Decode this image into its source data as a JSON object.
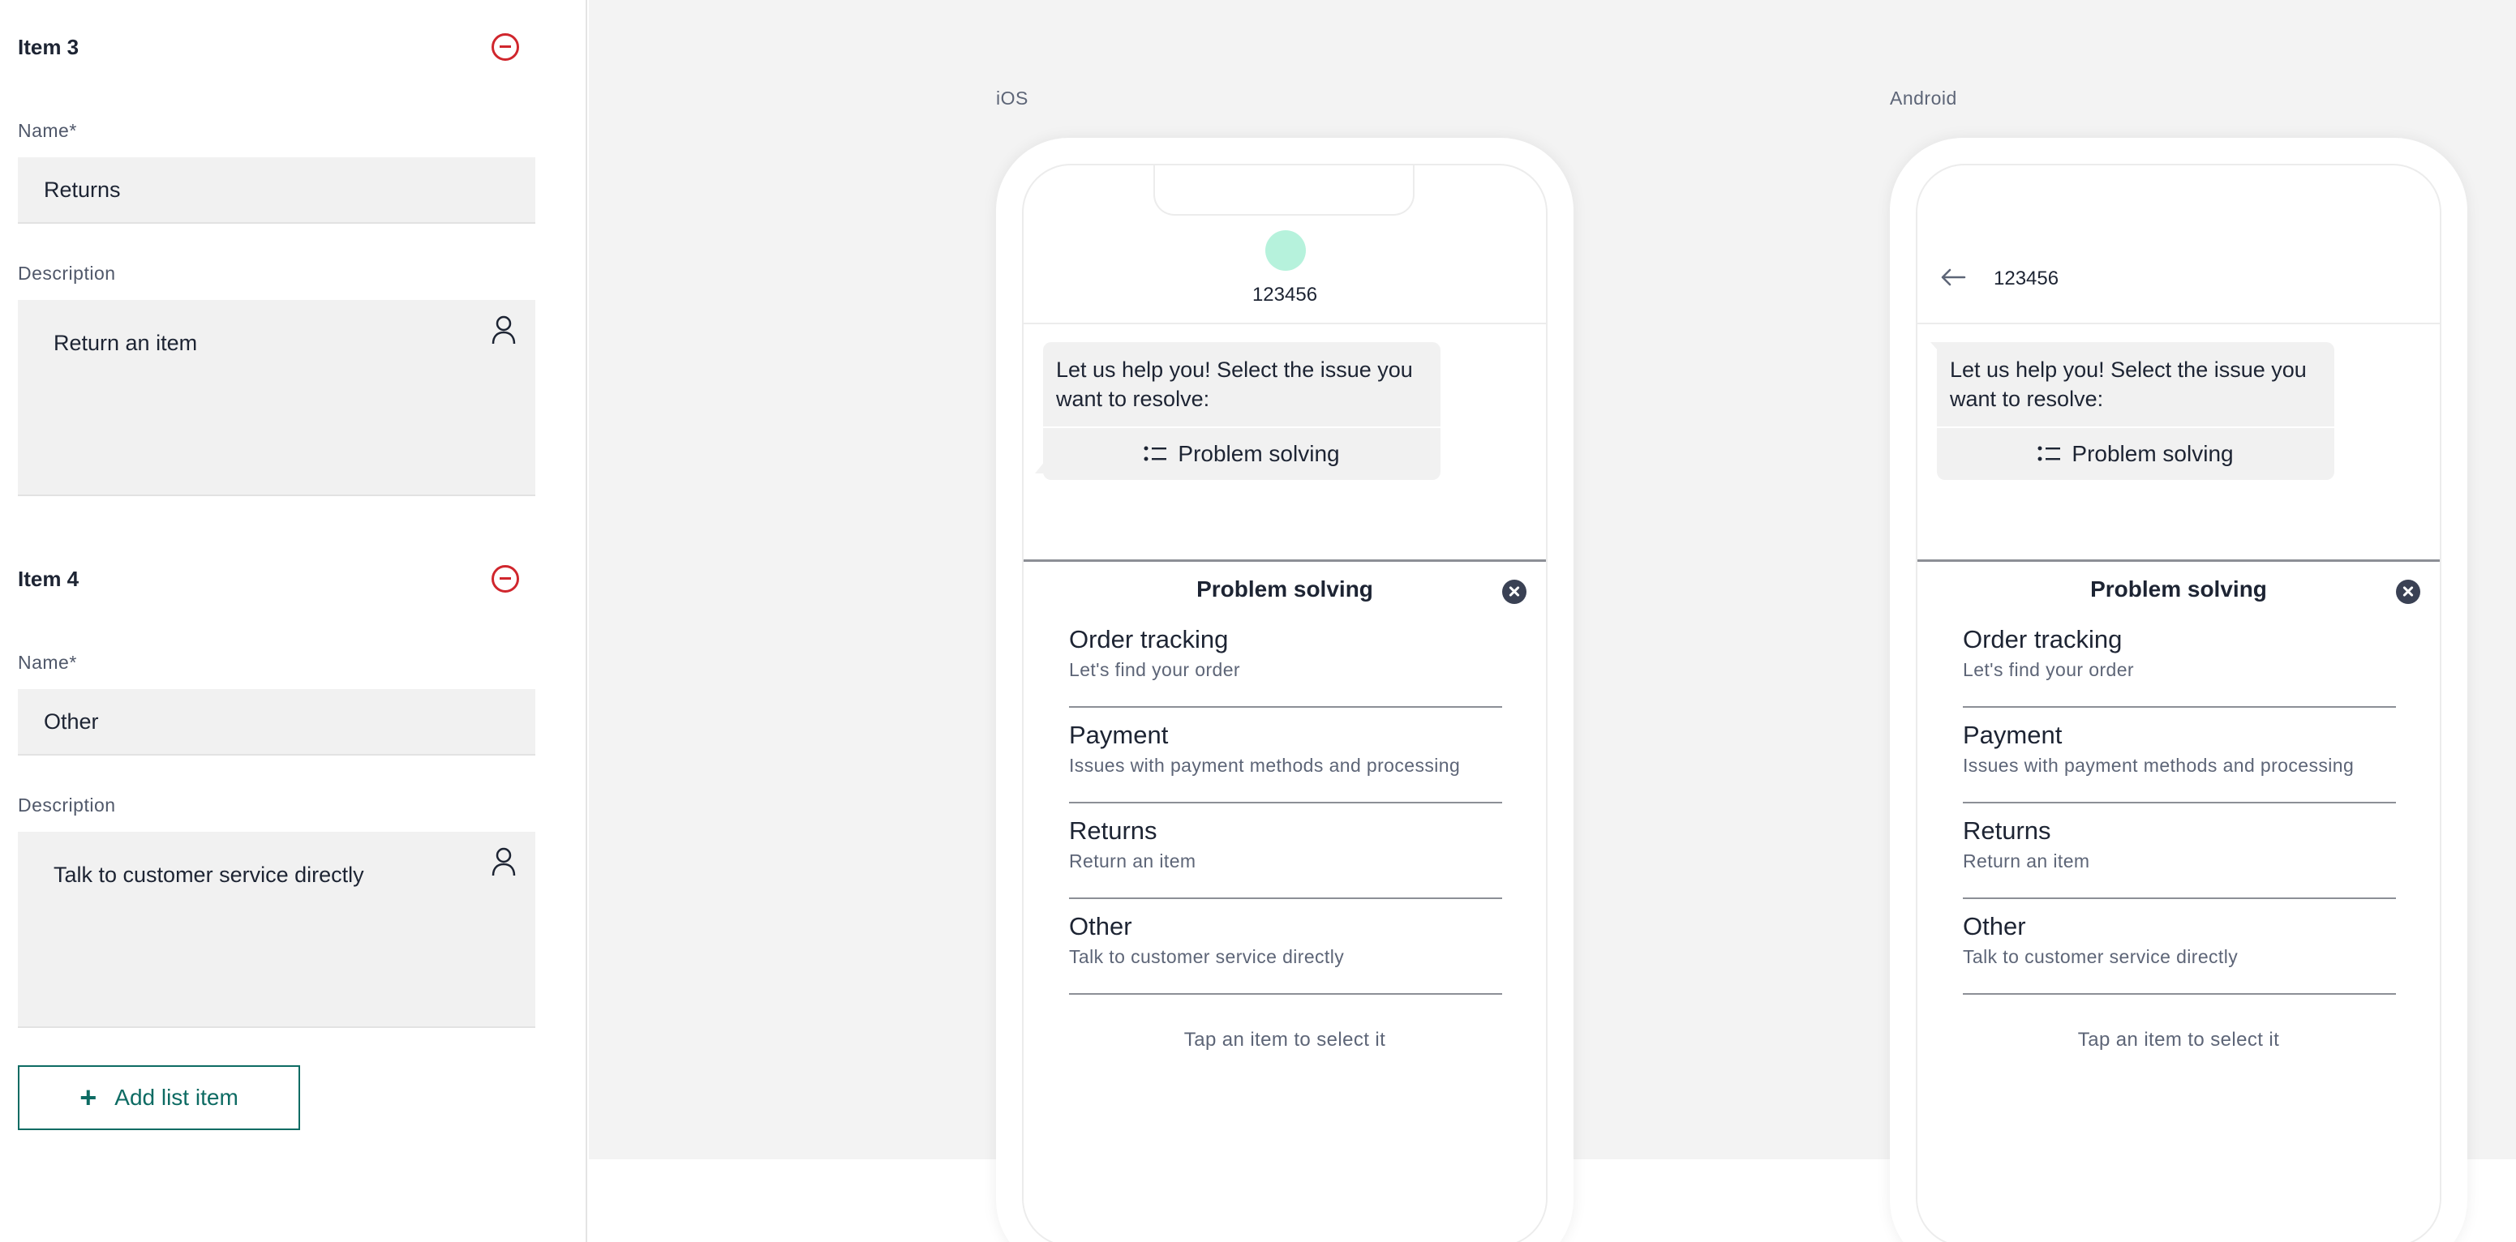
{
  "editor": {
    "items": [
      {
        "title": "Item 3",
        "name_label": "Name*",
        "name_value": "Returns",
        "description_label": "Description",
        "description_value": "Return an item"
      },
      {
        "title": "Item 4",
        "name_label": "Name*",
        "name_value": "Other",
        "description_label": "Description",
        "description_value": "Talk to customer service directly"
      }
    ],
    "add_button": {
      "icon": "plus-icon",
      "label": "Add list item"
    }
  },
  "preview": {
    "ios": {
      "label": "iOS",
      "contact_number": "123456"
    },
    "android": {
      "label": "Android",
      "contact_number": "123456"
    },
    "message": {
      "text": "Let us help you! Select the issue you want to resolve:",
      "action_label": "Problem solving",
      "action_icon": "list-icon"
    },
    "sheet": {
      "title": "Problem solving",
      "options": [
        {
          "title": "Order tracking",
          "description": "Let's find your order"
        },
        {
          "title": "Payment",
          "description": "Issues with payment methods and processing"
        },
        {
          "title": "Returns",
          "description": "Return an item"
        },
        {
          "title": "Other",
          "description": "Talk to customer service directly"
        }
      ],
      "hint": "Tap an item to select it"
    }
  },
  "colors": {
    "accent": "#0d6b63",
    "danger": "#d0262d",
    "avatar": "#b6f2dc",
    "panel_bg": "#f3f3f3",
    "input_bg": "#f1f1f1"
  }
}
